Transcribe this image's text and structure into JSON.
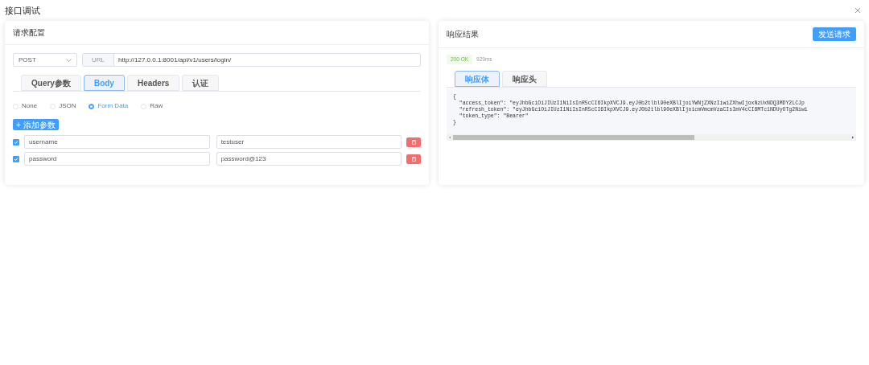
{
  "title": "接口调试",
  "request": {
    "title": "请求配置",
    "method": "POST",
    "url_label": "URL",
    "url": "http://127.0.0.1:8001/api/v1/users/login/",
    "tabs": [
      {
        "label": "Query参数",
        "selected": false
      },
      {
        "label": "Body",
        "selected": true
      },
      {
        "label": "Headers",
        "selected": false
      },
      {
        "label": "认证",
        "selected": false
      }
    ],
    "body_types": [
      {
        "label": "None",
        "selected": false
      },
      {
        "label": "JSON",
        "selected": false
      },
      {
        "label": "Form Data",
        "selected": true
      },
      {
        "label": "Raw",
        "selected": false
      }
    ],
    "add_button": "+ 添加参数",
    "params": [
      {
        "checked": true,
        "key": "username",
        "value": "testuser"
      },
      {
        "checked": true,
        "key": "password",
        "value": "password@123"
      }
    ]
  },
  "response": {
    "title": "响应结果",
    "send_button": "发送请求",
    "status": "200 OK",
    "time": "929ms",
    "tabs": [
      {
        "label": "响应体",
        "selected": true
      },
      {
        "label": "响应头",
        "selected": false
      }
    ],
    "body": [
      "{",
      "  \"access_token\": \"eyJhbGciOiJIUzI1NiIsInR5cCI6IkpXVCJ9.eyJ0b2tlbl90eXBlIjoiYWNjZXNzIiwiZXhwIjoxNzUxNDQ3MDY2LCJp",
      "  \"refresh_token\": \"eyJhbGciOiJIUzI1NiIsInR5cCI6IkpXVCJ9.eyJ0b2tlbl90eXBlIjoicmVmcmVzaCIsImV4cCI6MTc1NDUyOTg2Niwi",
      "  \"token_type\": \"Bearer\"",
      "}"
    ]
  }
}
